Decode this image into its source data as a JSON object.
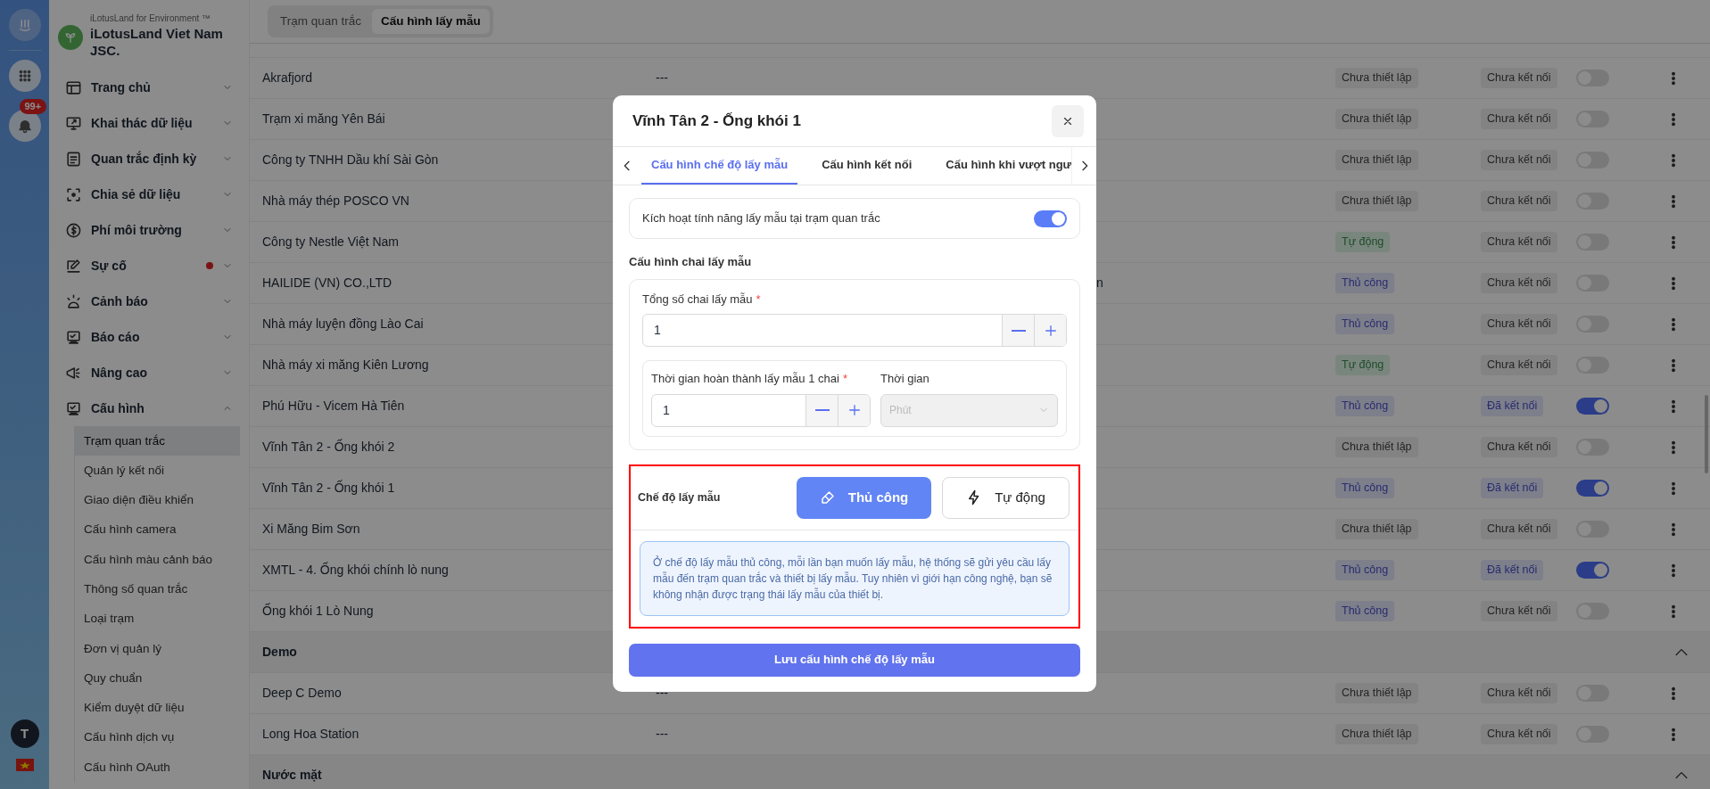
{
  "rail": {
    "notification_badge": "99+",
    "avatar_initial": "T"
  },
  "brand": {
    "tagline": "iLotusLand for Environment ™",
    "name": "iLotusLand Viet Nam JSC."
  },
  "nav": [
    {
      "label": "Trang chủ",
      "expanded": false,
      "has_alert": false
    },
    {
      "label": "Khai thác dữ liệu",
      "expanded": false,
      "has_alert": false
    },
    {
      "label": "Quan trắc định kỳ",
      "expanded": false,
      "has_alert": false
    },
    {
      "label": "Chia sẻ dữ liệu",
      "expanded": false,
      "has_alert": false
    },
    {
      "label": "Phí môi trường",
      "expanded": false,
      "has_alert": false
    },
    {
      "label": "Sự cố",
      "expanded": false,
      "has_alert": true
    },
    {
      "label": "Cảnh báo",
      "expanded": false,
      "has_alert": false
    },
    {
      "label": "Báo cáo",
      "expanded": false,
      "has_alert": false
    },
    {
      "label": "Nâng cao",
      "expanded": false,
      "has_alert": false
    },
    {
      "label": "Cấu hình",
      "expanded": true,
      "has_alert": false,
      "children": [
        {
          "label": "Trạm quan trắc",
          "selected": true
        },
        {
          "label": "Quản lý kết nối",
          "selected": false
        },
        {
          "label": "Giao diện điều khiển",
          "selected": false
        },
        {
          "label": "Cấu hình camera",
          "selected": false
        },
        {
          "label": "Cấu hình màu cảnh báo",
          "selected": false
        },
        {
          "label": "Thông số quan trắc",
          "selected": false
        },
        {
          "label": "Loại trạm",
          "selected": false
        },
        {
          "label": "Đơn vị quản lý",
          "selected": false
        },
        {
          "label": "Quy chuẩn",
          "selected": false
        },
        {
          "label": "Kiểm duyệt dữ liệu",
          "selected": false
        },
        {
          "label": "Cấu hình dịch vụ",
          "selected": false
        },
        {
          "label": "Cấu hình OAuth",
          "selected": false
        }
      ]
    }
  ],
  "page_tabs": [
    {
      "label": "Trạm quan trắc",
      "selected": false
    },
    {
      "label": "Cấu hình lấy mẫu",
      "selected": true
    }
  ],
  "table": {
    "rows": [
      {
        "kind": "station",
        "name": "Akrafjord",
        "column_2": "---",
        "mode": {
          "text": "Chưa thiết lập",
          "kind": "unset"
        },
        "connection": {
          "text": "Chưa kết nối",
          "connected": false
        },
        "on": false
      },
      {
        "kind": "station",
        "name": "Trạm xi măng Yên Bái",
        "mode": {
          "text": "Chưa thiết lập",
          "kind": "unset"
        },
        "connection": {
          "text": "Chưa kết nối",
          "connected": false
        },
        "on": false
      },
      {
        "kind": "station",
        "name": "Công ty TNHH Dầu khí Sài Gòn",
        "mode": {
          "text": "Chưa thiết lập",
          "kind": "unset"
        },
        "connection": {
          "text": "Chưa kết nối",
          "connected": false
        },
        "on": false
      },
      {
        "kind": "station",
        "name": "Nhà máy thép POSCO VN",
        "mode": {
          "text": "Chưa thiết lập",
          "kind": "unset"
        },
        "connection": {
          "text": "Chưa kết nối",
          "connected": false
        },
        "on": false
      },
      {
        "kind": "station",
        "name": "Công ty Nestle Việt Nam",
        "mode": {
          "text": "Tự động",
          "kind": "auto"
        },
        "connection": {
          "text": "Chưa kết nối",
          "connected": false
        },
        "on": false
      },
      {
        "kind": "station",
        "name": "HAILIDE (VN) CO.,LTD",
        "column_3": "n",
        "mode": {
          "text": "Thủ công",
          "kind": "manual"
        },
        "connection": {
          "text": "Chưa kết nối",
          "connected": false
        },
        "on": false
      },
      {
        "kind": "station",
        "name": "Nhà máy luyện đồng Lào Cai",
        "mode": {
          "text": "Thủ công",
          "kind": "manual"
        },
        "connection": {
          "text": "Chưa kết nối",
          "connected": false
        },
        "on": false
      },
      {
        "kind": "station",
        "name": "Nhà máy xi măng Kiên Lương",
        "mode": {
          "text": "Tự động",
          "kind": "auto"
        },
        "connection": {
          "text": "Chưa kết nối",
          "connected": false
        },
        "on": false
      },
      {
        "kind": "station",
        "name": "Phú Hữu - Vicem Hà Tiên",
        "mode": {
          "text": "Thủ công",
          "kind": "manual"
        },
        "connection": {
          "text": "Đã kết nối",
          "connected": true
        },
        "on": true
      },
      {
        "kind": "station",
        "name": "Vĩnh Tân 2 - Ống khói 2",
        "mode": {
          "text": "Chưa thiết lập",
          "kind": "unset"
        },
        "connection": {
          "text": "Chưa kết nối",
          "connected": false
        },
        "on": false
      },
      {
        "kind": "station",
        "name": "Vĩnh Tân 2 - Ống khói 1",
        "mode": {
          "text": "Thủ công",
          "kind": "manual"
        },
        "connection": {
          "text": "Đã kết nối",
          "connected": true
        },
        "on": true
      },
      {
        "kind": "station",
        "name": "Xi Măng Bim Sơn",
        "mode": {
          "text": "Chưa thiết lập",
          "kind": "unset"
        },
        "connection": {
          "text": "Chưa kết nối",
          "connected": false
        },
        "on": false
      },
      {
        "kind": "station",
        "name": "XMTL - 4. Ống khói chính lò nung",
        "mode": {
          "text": "Thủ công",
          "kind": "manual"
        },
        "connection": {
          "text": "Đã kết nối",
          "connected": true
        },
        "on": true
      },
      {
        "kind": "station",
        "name": "Ống khói 1 Lò Nung",
        "mode": {
          "text": "Thủ công",
          "kind": "manual"
        },
        "connection": {
          "text": "Chưa kết nối",
          "connected": false
        },
        "on": false
      },
      {
        "kind": "group",
        "name": "Demo",
        "expanded": true
      },
      {
        "kind": "station",
        "name": "Deep C Demo",
        "column_2": "---",
        "mode": {
          "text": "Chưa thiết lập",
          "kind": "unset"
        },
        "connection": {
          "text": "Chưa kết nối",
          "connected": false
        },
        "on": false
      },
      {
        "kind": "station",
        "name": "Long Hoa Station",
        "column_2": "---",
        "mode": {
          "text": "Chưa thiết lập",
          "kind": "unset"
        },
        "connection": {
          "text": "Chưa kết nối",
          "connected": false
        },
        "on": false
      },
      {
        "kind": "group",
        "name": "Nước mặt",
        "expanded": true
      }
    ]
  },
  "modal": {
    "title": "Vĩnh Tân 2 - Ống khói 1",
    "tabs": [
      {
        "label": "Cấu hình chế độ lấy mẫu",
        "selected": true
      },
      {
        "label": "Cấu hình kết nối",
        "selected": false
      },
      {
        "label": "Cấu hình khi vượt ngư",
        "selected": false
      }
    ],
    "activate": {
      "label": "Kích hoạt tính năng lấy mẫu tại trạm quan trắc",
      "on": true
    },
    "bottle_section": "Cấu hình chai lấy mẫu",
    "total_bottles": {
      "label": "Tổng số chai lấy mẫu",
      "required_mark": "*",
      "value": "1"
    },
    "completion_time": {
      "label": "Thời gian hoàn thành lấy mẫu 1 chai",
      "required_mark": "*",
      "value": "1"
    },
    "time_unit": {
      "label": "Thời gian",
      "value": "Phút",
      "disabled": true
    },
    "mode_label": "Chế độ lấy mẫu",
    "modes": [
      {
        "label": "Thủ công",
        "kind": "manual",
        "selected": true
      },
      {
        "label": "Tự động",
        "kind": "auto",
        "selected": false
      }
    ],
    "info": "Ở chế độ lấy mẫu thủ công, mỗi lần bạn muốn lấy mẫu, hệ thống sẽ gửi yêu cầu lấy mẫu đến trạm quan trắc và thiết bị lấy mẫu. Tuy nhiên vì giới hạn công nghệ, bạn sẽ không nhận được trạng thái lấy mẫu của thiết bị.",
    "save_button": "Lưu cấu hình chế độ lấy mẫu"
  }
}
